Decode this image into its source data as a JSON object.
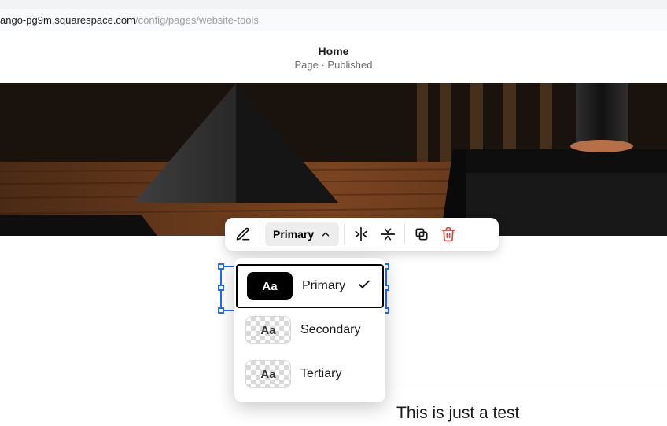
{
  "url": {
    "host": "ango-pg9m.squarespace.com",
    "path": "/config/pages/website-tools"
  },
  "header": {
    "title": "Home",
    "subtitle": "Page · Published"
  },
  "toolbar": {
    "style_button_label": "Primary"
  },
  "style_options": [
    {
      "label": "Primary",
      "swatch": "black",
      "text": "Aa",
      "selected": true
    },
    {
      "label": "Secondary",
      "swatch": "checker",
      "text": "Aa",
      "selected": false
    },
    {
      "label": "Tertiary",
      "swatch": "checker",
      "text": "Aa",
      "selected": false
    }
  ],
  "page": {
    "body_text": "This is just a test"
  }
}
